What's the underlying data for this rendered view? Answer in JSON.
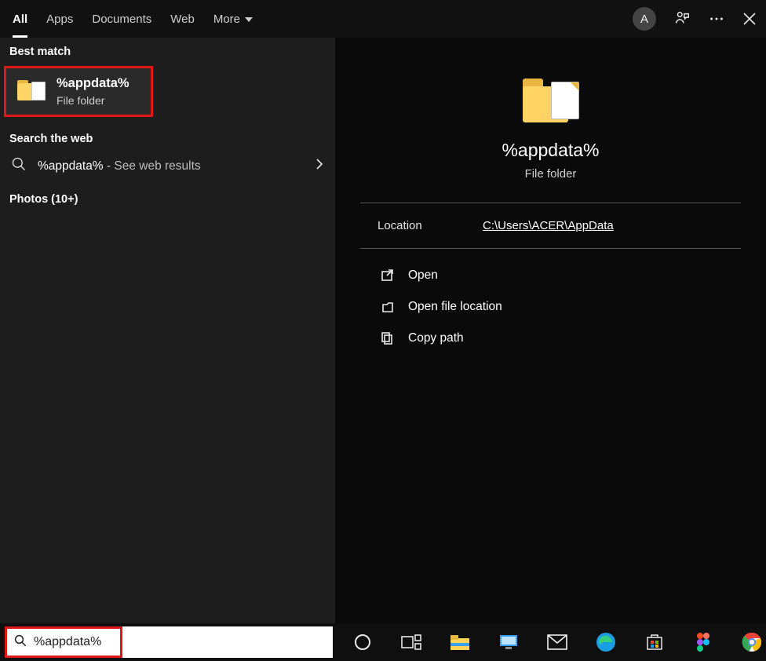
{
  "tabs": {
    "all": "All",
    "apps": "Apps",
    "documents": "Documents",
    "web": "Web",
    "more": "More"
  },
  "avatar": "A",
  "left": {
    "best_match_label": "Best match",
    "result_title": "%appdata%",
    "result_sub": "File folder",
    "search_web_label": "Search the web",
    "web_prefix": "%appdata%",
    "web_suffix": " - See web results",
    "photos_label": "Photos (10+)"
  },
  "preview": {
    "title": "%appdata%",
    "sub": "File folder",
    "location_label": "Location",
    "location_value": "C:\\Users\\ACER\\AppData",
    "actions": {
      "open": "Open",
      "open_loc": "Open file location",
      "copy_path": "Copy path"
    }
  },
  "search_input": "%appdata%"
}
